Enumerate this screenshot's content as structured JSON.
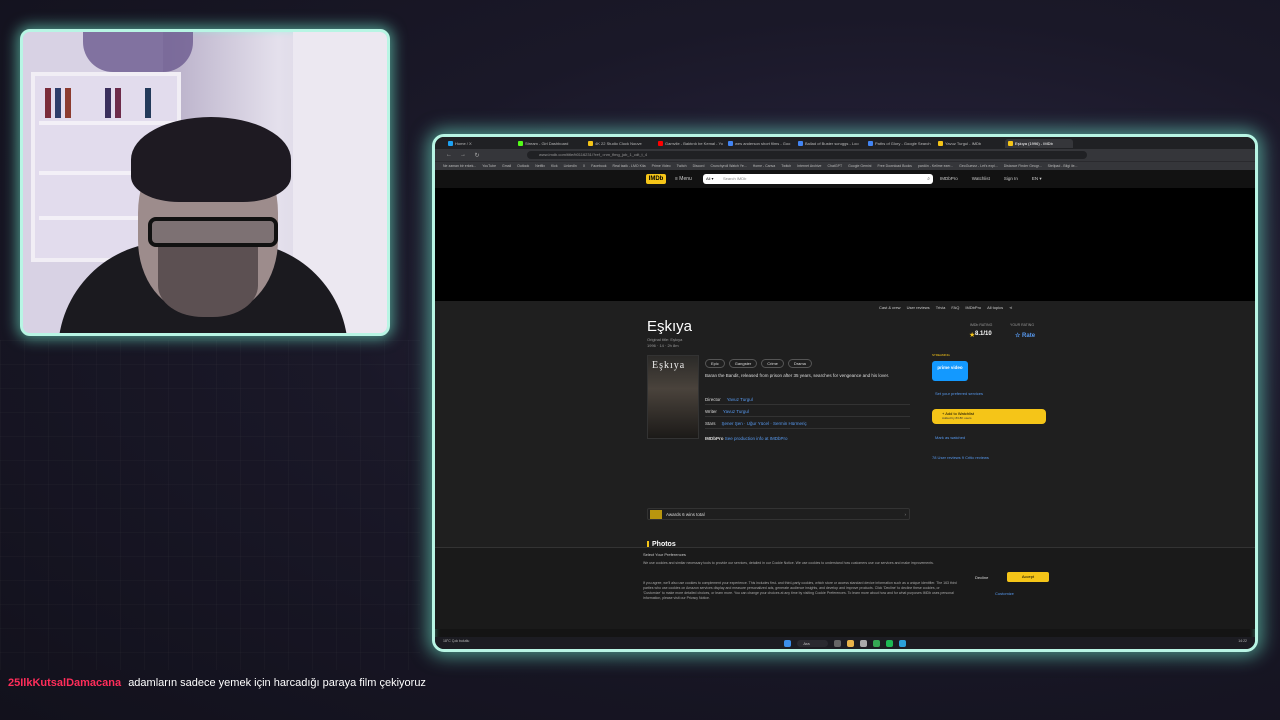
{
  "chat": {
    "username": "25IlkKutsalDamacana",
    "message": "adamların sadece yemek için harcadığı paraya film çekiyoruz"
  },
  "browser": {
    "tabs": [
      {
        "label": "Home / X",
        "color": "#1da1f2"
      },
      {
        "label": "Stream - Girl Dashboard",
        "color": "#53fc18"
      },
      {
        "label": "4K 22 Studio Clock Nouve",
        "color": "#f5c518"
      },
      {
        "label": "Gamvile - Baktırdı be Kemal - YouTube",
        "color": "#ff0000"
      },
      {
        "label": "wes anderson short films - Goo",
        "color": "#4285f4"
      },
      {
        "label": "Ballad of Buster scruggs - Loo",
        "color": "#4285f4"
      },
      {
        "label": "Paths of Glory - Google Search",
        "color": "#4285f4"
      },
      {
        "label": "Yavuz Turgul - IMDb",
        "color": "#f5c518"
      },
      {
        "label": "Eşkıya (1996) - IMDb",
        "color": "#f5c518",
        "active": true
      }
    ],
    "url": "www.imdb.com/title/tt0116231/?ref_=nm_flmg_job_1_cdt_t_4",
    "bookmarks": [
      "Ne zaman bir erkek...",
      "YouTube",
      "Gmail",
      "Outlook",
      "Netflix",
      "Kick",
      "LinkedIn",
      "X",
      "Facebook",
      "Real tazik - LMO Kita",
      "Prime Video",
      "Twitch",
      "Discord",
      "Crunchyroll Watch Ye...",
      "Home - Canva",
      "Twitch",
      "Internet Archive",
      "ChatGPT",
      "Google Gemini",
      "Free Download Books",
      "pardön - Kelime ezer...",
      "GeoGuessr - Let's expl...",
      "Distance Finder Geogr...",
      "Stellpad - Bilgi ile..."
    ]
  },
  "imdb": {
    "logo": "IMDb",
    "menu": "≡ Menu",
    "search_category": "All ▾",
    "search_placeholder": "Search IMDb",
    "header_right": [
      "IMDbPro",
      "Watchlist",
      "Sign In",
      "EN ▾"
    ],
    "subnav": [
      "Cast & crew",
      "User reviews",
      "Trivia",
      "FAQ",
      "IMDbPro",
      "All topics"
    ],
    "title": "Eşkıya",
    "original_title": "Original title: Eşkıya",
    "meta": "1996 · 14 · 2h 8m",
    "poster_text": "Eşkıya",
    "genres": [
      "Epic",
      "Gangster",
      "Crime",
      "Drama"
    ],
    "plot": "Baran the Bandit, released from prison after 35 years, searches for vengeance and his lover.",
    "director_label": "Director",
    "director": "Yavuz Turgul",
    "writer_label": "Writer",
    "writer": "Yavuz Turgul",
    "stars_label": "Stars",
    "stars": "Şener Şen · Uğur Yücel · Sermin Hürmeriç",
    "imdbpro_badge": "IMDbPro",
    "imdbpro_link": "See production info at IMDbPro",
    "imdb_rating_label": "IMDb RATING",
    "rating": "8.1/10",
    "rating_count": "84K",
    "your_rating_label": "YOUR RATING",
    "rate_label": "☆ Rate",
    "streaming_label": "STREAMING",
    "prime_label": "prime video",
    "provider_link": "Set your preferred services",
    "watchlist_label": "+ Add to Watchlist",
    "watchlist_sub": "Added by 83.8K users",
    "mark_watched": "Mark as watched",
    "reviews": "78 User reviews   9 Critic reviews",
    "awards": "Awards   6 wins total",
    "photos": "Photos"
  },
  "cookies": {
    "title": "Select Your Preferences",
    "p1": "We use cookies and similar necessary tools to provide our services, detailed in our Cookie Notice. We use cookies to understand how customers use our services and make improvements.",
    "p2": "If you agree, we'll also use cookies to complement your experience. This includes first- and third-party cookies, which store or access standard device information such as a unique identifier. The 163 third parties who use cookies on Amazon services display and measure personalized ads, generate audience insights, and develop and improve products. Click 'Decline' to decline these cookies, or 'Customize' to make more detailed choices, or learn more. You can change your choices at any time by visiting Cookie Preferences. To learn more about how and for what purposes IMDb uses personal information, please visit our Privacy Notice.",
    "decline": "Decline",
    "accept": "Accept",
    "customize": "Customize"
  },
  "taskbar": {
    "weather": "18°C Çok bulutlu",
    "search": "Ara",
    "clock": "14:22"
  }
}
